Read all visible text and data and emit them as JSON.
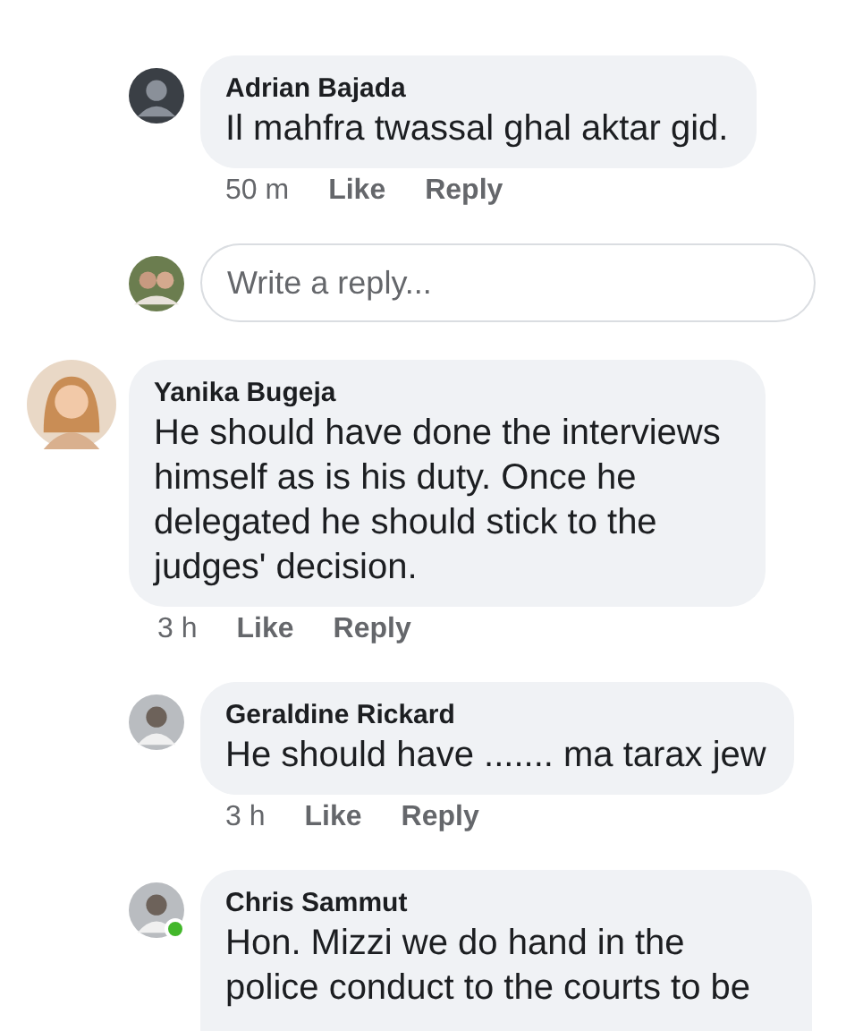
{
  "thread_tail": {
    "replies": [
      {
        "author": "Adrian Bajada",
        "text": "Il mahfra twassal ghal aktar gid.",
        "time": "50 m",
        "actions": [
          "Like",
          "Reply"
        ],
        "online": false
      }
    ],
    "reply_box": {
      "placeholder": "Write a reply..."
    }
  },
  "comments": [
    {
      "author": "Yanika Bugeja",
      "text": "He should have done the interviews himself as is his duty. Once he delegated he should stick to the judges' decision.",
      "time": "3 h",
      "actions": [
        "Like",
        "Reply"
      ],
      "online": false,
      "replies": [
        {
          "author": "Geraldine Rickard",
          "text": "He should have ....... ma tarax jew",
          "time": "3 h",
          "actions": [
            "Like",
            "Reply"
          ],
          "online": false
        },
        {
          "author": "Chris Sammut",
          "text": "Hon. Mizzi we do hand in the police conduct to the courts to be",
          "online": true
        }
      ]
    }
  ]
}
